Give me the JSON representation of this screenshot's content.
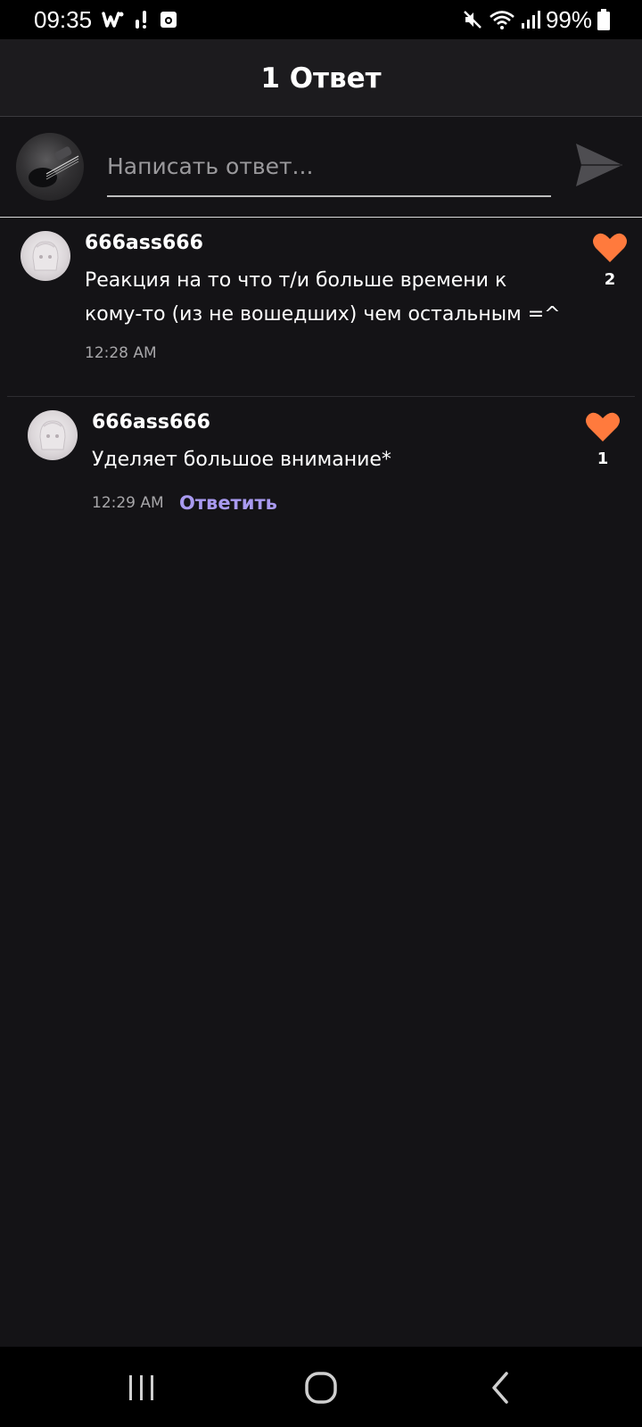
{
  "status_bar": {
    "time": "09:35",
    "battery": "99%",
    "icons_left": [
      "wattpad-icon",
      "notification-dots-icon",
      "screen-record-icon"
    ],
    "icons_right": [
      "mute-icon",
      "wifi-icon",
      "signal-icon",
      "battery-icon"
    ]
  },
  "header": {
    "title": "1 Ответ"
  },
  "composer": {
    "placeholder": "Написать ответ...",
    "value": ""
  },
  "comments": [
    {
      "author": "666ass666",
      "text": "Реакция на то что т/и больше времени к кому-то (из не вошедших) чем остальным =^",
      "time": "12:28 AM",
      "likes": "2"
    },
    {
      "author": "666ass666",
      "text": "Уделяет большое внимание*",
      "time": "12:29 AM",
      "likes": "1",
      "reply_label": "Ответить"
    }
  ],
  "colors": {
    "background": "#141316",
    "header": "#1c1b1e",
    "like": "#ff7a3d",
    "reply_link": "#a99af0"
  }
}
